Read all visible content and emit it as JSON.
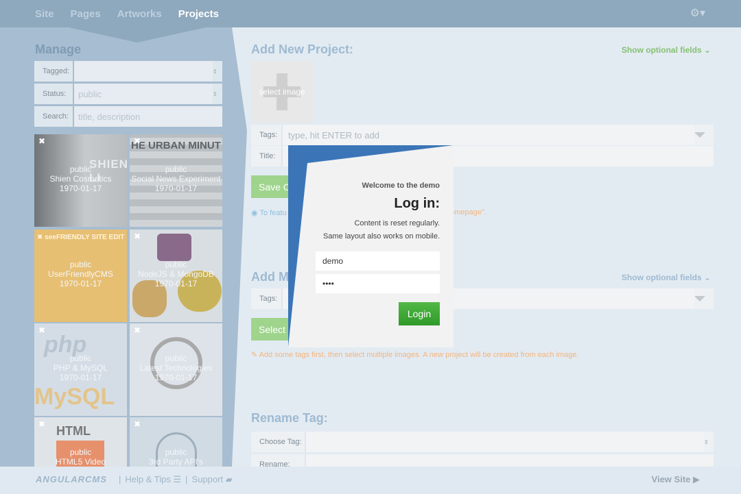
{
  "nav": {
    "items": [
      "Site",
      "Pages",
      "Artworks",
      "Projects"
    ],
    "active_index": 3,
    "settings_icon": "gear-icon"
  },
  "sidebar": {
    "title": "Manage",
    "filters": [
      {
        "label": "Tagged:",
        "value": ""
      },
      {
        "label": "Status:",
        "value": "public"
      },
      {
        "label": "Search:",
        "placeholder": "title, description"
      }
    ],
    "items": [
      {
        "status": "public",
        "title": "Shien Cosmetics",
        "date": "1970-01-17"
      },
      {
        "status": "public",
        "title": "Social News Experiment",
        "date": "1970-01-17"
      },
      {
        "status": "public",
        "title": "UserFriendlyCMS",
        "date": "1970-01-17"
      },
      {
        "status": "public",
        "title": "NodeJS & MongoDB",
        "date": "1970-01-17"
      },
      {
        "status": "public",
        "title": "PHP & MySQL",
        "date": "1970-01-17"
      },
      {
        "status": "public",
        "title": "Latest Technologies",
        "date": "1970-01-17"
      },
      {
        "status": "public",
        "title": "HTML5 Video",
        "date": ""
      },
      {
        "status": "public",
        "title": "3rd Party API's",
        "date": ""
      }
    ],
    "thumb_art": [
      "SHIEN LI",
      "HE URBAN MINUT",
      "✖ seeFRIENDLY SITE EDIT",
      "",
      "php",
      "",
      "HTML",
      ""
    ]
  },
  "add_project": {
    "title": "Add New Project:",
    "optional_label": "Show optional fields",
    "select_image": "select image",
    "tags_label": "Tags:",
    "tags_placeholder": "type, hit ENTER to add",
    "title_label": "Title:",
    "save_label": "Save C",
    "hint_left": "To featu",
    "hint_right": "omepage\"."
  },
  "add_multiple": {
    "title": "Add M",
    "optional_label": "Show optional fields",
    "tags_label": "Tags:",
    "select_label": "Select",
    "hint": "Add some tags first, then select multiple images. A new project will be created from each image."
  },
  "rename_tag": {
    "title": "Rename Tag:",
    "choose_label": "Choose Tag:",
    "rename_label": "Rename:"
  },
  "login": {
    "welcome": "Welcome to the demo",
    "title": "Log in:",
    "line1": "Content is reset regularly.",
    "line2": "Same layout also works on mobile.",
    "username": "demo",
    "password": "••••",
    "button": "Login"
  },
  "footer": {
    "logo": "ANGULARCMS",
    "sep1": "|",
    "help": "Help & Tips",
    "sep2": "|",
    "support": "Support",
    "view_site": "View Site"
  },
  "colors": {
    "accent_blue": "#3b75b7",
    "login_green": "#3da835",
    "optional_green": "#86c072",
    "hint_orange": "#f2b47c"
  }
}
